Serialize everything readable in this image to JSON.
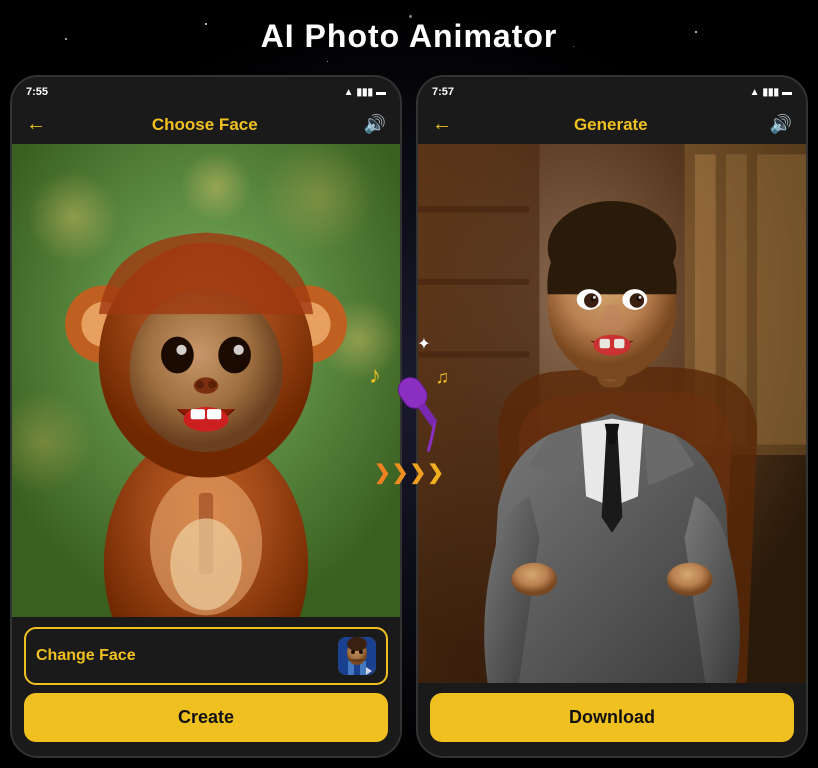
{
  "page": {
    "title": "AI Photo Animator",
    "background": "#000"
  },
  "phone_left": {
    "status_time": "7:55",
    "nav_title": "Choose Face",
    "nav_back": "←",
    "nav_sound_icon": "🔊",
    "change_face_label": "Change Face",
    "create_button_label": "Create"
  },
  "phone_right": {
    "status_time": "7:57",
    "nav_title": "Generate",
    "nav_back": "←",
    "nav_sound_icon": "🔊",
    "download_button_label": "Download"
  },
  "overlay": {
    "music_note_left": "♪",
    "music_note_right": "♫",
    "sparkle": "✦"
  },
  "icons": {
    "back_arrow": "←",
    "sound": "🔊",
    "wifi": "▲",
    "signal": "▮▮▮",
    "battery": "🔋",
    "chevrons": "❯❯❯❯"
  }
}
